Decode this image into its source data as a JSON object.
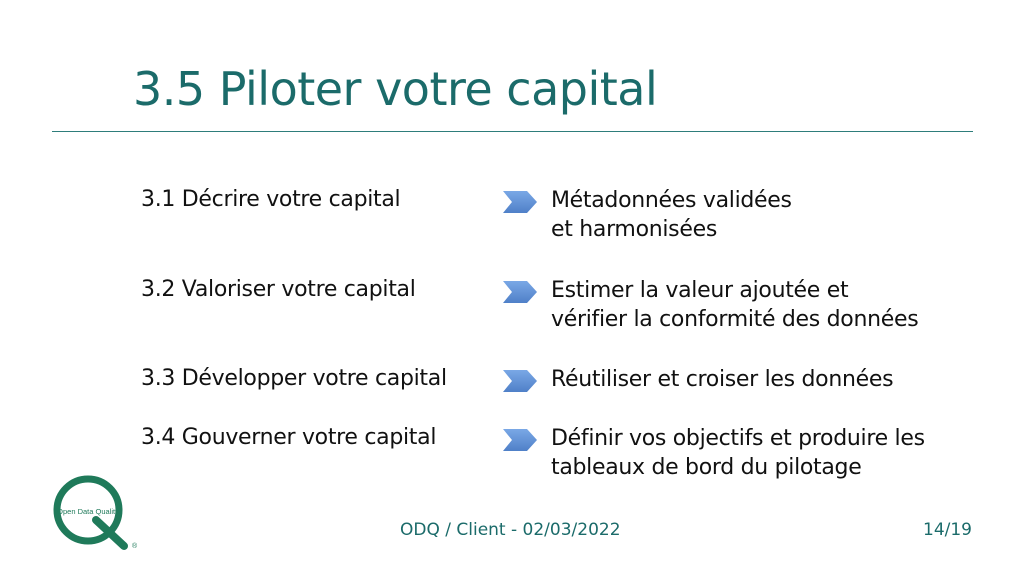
{
  "slide": {
    "title": "3.5 Piloter votre capital",
    "items": [
      {
        "label": "3.1 Décrire votre capital",
        "desc": [
          "Métadonnées validées",
          "et harmonisées"
        ]
      },
      {
        "label": "3.2 Valoriser votre capital",
        "desc": [
          "Estimer la valeur ajoutée et",
          "vérifier la conformité des données"
        ]
      },
      {
        "label": "3.3 Développer votre capital",
        "desc": [
          "Réutiliser et croiser les données"
        ]
      },
      {
        "label": "3.4 Gouverner votre capital",
        "desc": [
          "Définir vos objectifs et produire les",
          "tableaux de bord du pilotage"
        ]
      }
    ],
    "arrow_icon": "chevron-arrow-icon",
    "arrow_color": "#5b8fd6",
    "accent_color": "#1b6b6a"
  },
  "logo": {
    "icon": "odq-q-logo-icon",
    "text": "Open Data Quality",
    "registered": "®"
  },
  "footer": {
    "center": "ODQ / Client - 02/03/2022",
    "page": "14/19"
  }
}
